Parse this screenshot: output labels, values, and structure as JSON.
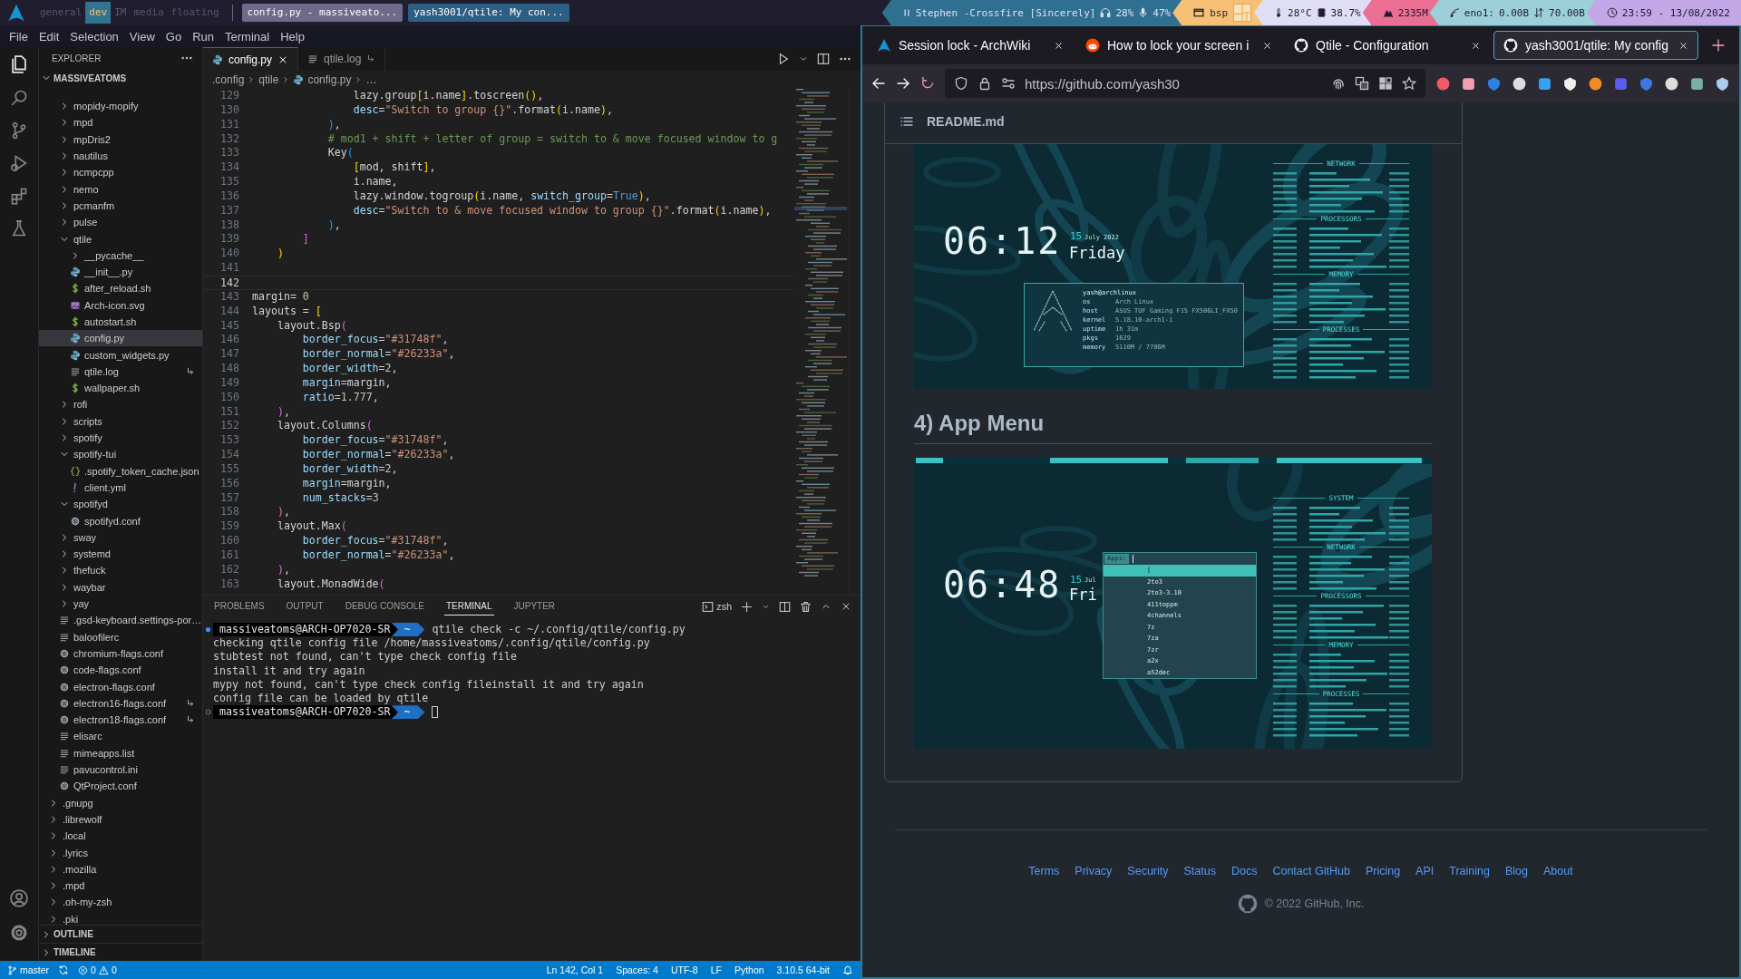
{
  "top_bar": {
    "groups": [
      {
        "label": "general",
        "selected": false
      },
      {
        "label": "dev",
        "selected": true
      },
      {
        "label": "IM",
        "selected": false
      },
      {
        "label": "media",
        "selected": false
      },
      {
        "label": "floating",
        "selected": false
      }
    ],
    "windows": [
      {
        "label": "config.py - massiveato...",
        "color": "#6e6a8a"
      },
      {
        "label": "yash3001/qtile: My con...",
        "color": "#2d5f84"
      }
    ],
    "widgets": [
      {
        "color": "#2f7090",
        "parts": [
          {
            "kind": "pause",
            "text": "Stephen -Crossfire [Sincerely]"
          },
          {
            "kind": "headphones",
            "text": "28%"
          },
          {
            "kind": "mic",
            "text": "47%"
          }
        ]
      },
      {
        "color": "#f6c177",
        "parts": [
          {
            "kind": "window",
            "text": "bsp"
          },
          {
            "kind": "layout"
          }
        ]
      },
      {
        "color": "#e0def4",
        "parts": [
          {
            "kind": "thermometer",
            "text": "28°C"
          },
          {
            "kind": "chip",
            "text": "38.7%"
          }
        ]
      },
      {
        "color": "#eb6f92",
        "parts": [
          {
            "kind": "ram",
            "text": "2335M"
          }
        ]
      },
      {
        "color": "#9ccfd8",
        "parts": [
          {
            "kind": "signal",
            "text": "eno1:"
          },
          {
            "kind": "plain",
            "text": "0.00B"
          },
          {
            "kind": "updown",
            "text": "70.00B"
          }
        ]
      },
      {
        "color": "#c4a7e7",
        "parts": [
          {
            "kind": "clock",
            "text": "23:59 - 13/08/2022"
          }
        ]
      }
    ]
  },
  "vscode": {
    "menu": [
      "File",
      "Edit",
      "Selection",
      "View",
      "Go",
      "Run",
      "Terminal",
      "Help"
    ],
    "explorer": {
      "title": "EXPLORER",
      "root": "MASSIVEATOMS",
      "tree": [
        {
          "children": [
            {
              "name": "mopidy-mopify",
              "kind": "folder",
              "expanded": false,
              "selected": false
            },
            {
              "name": "mpd",
              "kind": "folder",
              "expanded": false,
              "selected": false
            },
            {
              "name": "mpDris2",
              "kind": "folder",
              "expanded": false,
              "selected": false
            },
            {
              "name": "nautilus",
              "kind": "folder",
              "expanded": false,
              "selected": false
            },
            {
              "name": "ncmpcpp",
              "kind": "folder",
              "expanded": false,
              "selected": false
            },
            {
              "name": "nemo",
              "kind": "folder",
              "expanded": false,
              "selected": false
            },
            {
              "name": "pcmanfm",
              "kind": "folder",
              "expanded": false,
              "selected": false
            },
            {
              "name": "pulse",
              "kind": "folder",
              "expanded": false,
              "selected": false
            },
            {
              "name": "qtile",
              "kind": "folder",
              "expanded": true,
              "selected": false,
              "children": [
                {
                  "name": "__pycache__",
                  "kind": "folder",
                  "expanded": false,
                  "selected": false
                },
                {
                  "name": "__init__.py",
                  "kind": "python",
                  "selected": false,
                  "symlink": false
                },
                {
                  "name": "after_reload.sh",
                  "kind": "shell",
                  "selected": false,
                  "symlink": false
                },
                {
                  "name": "Arch-icon.svg",
                  "kind": "svg",
                  "selected": false,
                  "symlink": false
                },
                {
                  "name": "autostart.sh",
                  "kind": "shell",
                  "selected": false,
                  "symlink": false
                },
                {
                  "name": "config.py",
                  "kind": "python",
                  "selected": true,
                  "symlink": false
                },
                {
                  "name": "custom_widgets.py",
                  "kind": "python",
                  "selected": false,
                  "symlink": false
                },
                {
                  "name": "qtile.log",
                  "kind": "text",
                  "selected": false,
                  "symlink": true
                },
                {
                  "name": "wallpaper.sh",
                  "kind": "shell",
                  "selected": false,
                  "symlink": false
                }
              ]
            },
            {
              "name": "rofi",
              "kind": "folder",
              "expanded": false,
              "selected": false
            },
            {
              "name": "scripts",
              "kind": "folder",
              "expanded": false,
              "selected": false
            },
            {
              "name": "spotify",
              "kind": "folder",
              "expanded": false,
              "selected": false
            },
            {
              "name": "spotify-tui",
              "kind": "folder",
              "expanded": true,
              "selected": false,
              "children": [
                {
                  "name": ".spotify_token_cache.json",
                  "kind": "json",
                  "selected": false,
                  "symlink": false
                },
                {
                  "name": "client.yml",
                  "kind": "yaml",
                  "selected": false,
                  "symlink": false
                }
              ]
            },
            {
              "name": "spotifyd",
              "kind": "folder",
              "expanded": true,
              "selected": false,
              "children": [
                {
                  "name": "spotifyd.conf",
                  "kind": "conf",
                  "selected": false,
                  "symlink": false
                }
              ]
            },
            {
              "name": "sway",
              "kind": "folder",
              "expanded": false,
              "selected": false
            },
            {
              "name": "systemd",
              "kind": "folder",
              "expanded": false,
              "selected": false
            },
            {
              "name": "thefuck",
              "kind": "folder",
              "expanded": false,
              "selected": false
            },
            {
              "name": "waybar",
              "kind": "folder",
              "expanded": false,
              "selected": false
            },
            {
              "name": "yay",
              "kind": "folder",
              "expanded": false,
              "selected": false
            },
            {
              "name": ".gsd-keyboard.settings-por…",
              "kind": "text",
              "selected": false,
              "symlink": false
            },
            {
              "name": "baloofilerc",
              "kind": "text",
              "selected": false,
              "symlink": false
            },
            {
              "name": "chromium-flags.conf",
              "kind": "conf",
              "selected": false,
              "symlink": false
            },
            {
              "name": "code-flags.conf",
              "kind": "conf",
              "selected": false,
              "symlink": false
            },
            {
              "name": "electron-flags.conf",
              "kind": "conf",
              "selected": false,
              "symlink": false
            },
            {
              "name": "electron16-flags.conf",
              "kind": "conf",
              "selected": false,
              "symlink": true
            },
            {
              "name": "electron18-flags.conf",
              "kind": "conf",
              "selected": false,
              "symlink": true
            },
            {
              "name": "elisarc",
              "kind": "text",
              "selected": false,
              "symlink": false
            },
            {
              "name": "mimeapps.list",
              "kind": "text",
              "selected": false,
              "symlink": false
            },
            {
              "name": "pavucontrol.ini",
              "kind": "text",
              "selected": false,
              "symlink": false
            },
            {
              "name": "QtProject.conf",
              "kind": "conf",
              "selected": false,
              "symlink": false
            }
          ]
        },
        {
          "name": ".gnupg",
          "kind": "folder",
          "expanded": false,
          "selected": false
        },
        {
          "name": ".librewolf",
          "kind": "folder",
          "expanded": false,
          "selected": false
        },
        {
          "name": ".local",
          "kind": "folder",
          "expanded": false,
          "selected": false
        },
        {
          "name": ".lyrics",
          "kind": "folder",
          "expanded": false,
          "selected": false
        },
        {
          "name": ".mozilla",
          "kind": "folder",
          "expanded": false,
          "selected": false
        },
        {
          "name": ".mpd",
          "kind": "folder",
          "expanded": false,
          "selected": false
        },
        {
          "name": ".oh-my-zsh",
          "kind": "folder",
          "expanded": false,
          "selected": false
        },
        {
          "name": ".pki",
          "kind": "folder",
          "expanded": false,
          "selected": false
        }
      ]
    },
    "sections": [
      {
        "label": "OUTLINE",
        "expanded": false
      },
      {
        "label": "TIMELINE",
        "expanded": false
      }
    ],
    "editor_tabs": [
      {
        "label": "config.py",
        "kind": "python",
        "selected": true,
        "symlink": false
      },
      {
        "label": "qtile.log",
        "kind": "text",
        "selected": false,
        "symlink": true
      }
    ],
    "breadcrumbs": [
      {
        "label": ".config"
      },
      {
        "label": "qtile"
      },
      {
        "label": "config.py",
        "kind": "python"
      },
      {
        "label": "…"
      }
    ],
    "lines": [
      {
        "n": "129",
        "current": false,
        "tokens": [
          {
            "text": "                lazy.group",
            "kind": "plain"
          },
          {
            "text": "[",
            "kind": "gold"
          },
          {
            "text": "i.name",
            "kind": "plain"
          },
          {
            "text": "]",
            "kind": "gold"
          },
          {
            "text": ".toscreen",
            "kind": "plain"
          },
          {
            "text": "()",
            "kind": "gold"
          },
          {
            "text": ",",
            "kind": "plain"
          }
        ]
      },
      {
        "n": "130",
        "current": false,
        "tokens": [
          {
            "text": "                desc",
            "kind": "param"
          },
          {
            "text": "=",
            "kind": "plain"
          },
          {
            "text": "\"Switch to group {}\"",
            "kind": "string"
          },
          {
            "text": ".format",
            "kind": "plain"
          },
          {
            "text": "(",
            "kind": "gold"
          },
          {
            "text": "i.name",
            "kind": "plain"
          },
          {
            "text": ")",
            "kind": "gold"
          },
          {
            "text": ",",
            "kind": "plain"
          }
        ]
      },
      {
        "n": "131",
        "current": false,
        "tokens": [
          {
            "text": "            )",
            "kind": "blue"
          },
          {
            "text": ",",
            "kind": "plain"
          }
        ]
      },
      {
        "n": "132",
        "current": false,
        "tokens": [
          {
            "text": "            # mod1 + shift + letter of group = switch to & move focused window to g",
            "kind": "comment"
          }
        ]
      },
      {
        "n": "133",
        "current": false,
        "tokens": [
          {
            "text": "            Key",
            "kind": "plain"
          },
          {
            "text": "(",
            "kind": "blue"
          }
        ]
      },
      {
        "n": "134",
        "current": false,
        "tokens": [
          {
            "text": "                [",
            "kind": "gold"
          },
          {
            "text": "mod, shift",
            "kind": "plain"
          },
          {
            "text": "]",
            "kind": "gold"
          },
          {
            "text": ",",
            "kind": "plain"
          }
        ]
      },
      {
        "n": "135",
        "current": false,
        "tokens": [
          {
            "text": "                i.name,",
            "kind": "plain"
          }
        ]
      },
      {
        "n": "136",
        "current": false,
        "tokens": [
          {
            "text": "                lazy.window.togroup",
            "kind": "plain"
          },
          {
            "text": "(",
            "kind": "gold"
          },
          {
            "text": "i.name,",
            "kind": "plain"
          },
          {
            "text": " switch_group",
            "kind": "param"
          },
          {
            "text": "=",
            "kind": "plain"
          },
          {
            "text": "True",
            "kind": "constant"
          },
          {
            "text": ")",
            "kind": "gold"
          },
          {
            "text": ",",
            "kind": "plain"
          }
        ]
      },
      {
        "n": "137",
        "current": false,
        "tokens": [
          {
            "text": "                desc",
            "kind": "param"
          },
          {
            "text": "=",
            "kind": "plain"
          },
          {
            "text": "\"Switch to & move focused window to group {}\"",
            "kind": "string"
          },
          {
            "text": ".format",
            "kind": "plain"
          },
          {
            "text": "(",
            "kind": "gold"
          },
          {
            "text": "i.name",
            "kind": "plain"
          },
          {
            "text": ")",
            "kind": "gold"
          },
          {
            "text": ",",
            "kind": "plain"
          }
        ]
      },
      {
        "n": "138",
        "current": false,
        "tokens": [
          {
            "text": "            )",
            "kind": "blue"
          },
          {
            "text": ",",
            "kind": "plain"
          }
        ]
      },
      {
        "n": "139",
        "current": false,
        "tokens": [
          {
            "text": "        ]",
            "kind": "purple"
          }
        ]
      },
      {
        "n": "140",
        "current": false,
        "tokens": [
          {
            "text": "    )",
            "kind": "gold"
          }
        ]
      },
      {
        "n": "141",
        "current": false
      },
      {
        "n": "142",
        "current": true
      },
      {
        "n": "143",
        "current": false,
        "tokens": [
          {
            "text": "margin= ",
            "kind": "plain"
          },
          {
            "text": "0",
            "kind": "number"
          }
        ]
      },
      {
        "n": "144",
        "current": false,
        "tokens": [
          {
            "text": "layouts = ",
            "kind": "plain"
          },
          {
            "text": "[",
            "kind": "gold"
          }
        ]
      },
      {
        "n": "145",
        "current": false,
        "tokens": [
          {
            "text": "    layout.Bsp",
            "kind": "plain"
          },
          {
            "text": "(",
            "kind": "purple"
          }
        ]
      },
      {
        "n": "146",
        "current": false,
        "tokens": [
          {
            "text": "        border_focus",
            "kind": "param"
          },
          {
            "text": "=",
            "kind": "plain"
          },
          {
            "text": "\"#31748f\"",
            "kind": "string"
          },
          {
            "text": ",",
            "kind": "plain"
          }
        ]
      },
      {
        "n": "147",
        "current": false,
        "tokens": [
          {
            "text": "        border_normal",
            "kind": "param"
          },
          {
            "text": "=",
            "kind": "plain"
          },
          {
            "text": "\"#26233a\"",
            "kind": "string"
          },
          {
            "text": ",",
            "kind": "plain"
          }
        ]
      },
      {
        "n": "148",
        "current": false,
        "tokens": [
          {
            "text": "        border_width",
            "kind": "param"
          },
          {
            "text": "=",
            "kind": "plain"
          },
          {
            "text": "2",
            "kind": "number"
          },
          {
            "text": ",",
            "kind": "plain"
          }
        ]
      },
      {
        "n": "149",
        "current": false,
        "tokens": [
          {
            "text": "        margin",
            "kind": "param"
          },
          {
            "text": "=margin,",
            "kind": "plain"
          }
        ]
      },
      {
        "n": "150",
        "current": false,
        "tokens": [
          {
            "text": "        ratio",
            "kind": "param"
          },
          {
            "text": "=",
            "kind": "plain"
          },
          {
            "text": "1.777",
            "kind": "number"
          },
          {
            "text": ",",
            "kind": "plain"
          }
        ]
      },
      {
        "n": "151",
        "current": false,
        "tokens": [
          {
            "text": "    )",
            "kind": "purple"
          },
          {
            "text": ",",
            "kind": "plain"
          }
        ]
      },
      {
        "n": "152",
        "current": false,
        "tokens": [
          {
            "text": "    layout.Columns",
            "kind": "plain"
          },
          {
            "text": "(",
            "kind": "purple"
          }
        ]
      },
      {
        "n": "153",
        "current": false,
        "tokens": [
          {
            "text": "        border_focus",
            "kind": "param"
          },
          {
            "text": "=",
            "kind": "plain"
          },
          {
            "text": "\"#31748f\"",
            "kind": "string"
          },
          {
            "text": ",",
            "kind": "plain"
          }
        ]
      },
      {
        "n": "154",
        "current": false,
        "tokens": [
          {
            "text": "        border_normal",
            "kind": "param"
          },
          {
            "text": "=",
            "kind": "plain"
          },
          {
            "text": "\"#26233a\"",
            "kind": "string"
          },
          {
            "text": ",",
            "kind": "plain"
          }
        ]
      },
      {
        "n": "155",
        "current": false,
        "tokens": [
          {
            "text": "        border_width",
            "kind": "param"
          },
          {
            "text": "=",
            "kind": "plain"
          },
          {
            "text": "2",
            "kind": "number"
          },
          {
            "text": ",",
            "kind": "plain"
          }
        ]
      },
      {
        "n": "156",
        "current": false,
        "tokens": [
          {
            "text": "        margin",
            "kind": "param"
          },
          {
            "text": "=margin,",
            "kind": "plain"
          }
        ]
      },
      {
        "n": "157",
        "current": false,
        "tokens": [
          {
            "text": "        num_stacks",
            "kind": "param"
          },
          {
            "text": "=",
            "kind": "plain"
          },
          {
            "text": "3",
            "kind": "number"
          }
        ]
      },
      {
        "n": "158",
        "current": false,
        "tokens": [
          {
            "text": "    )",
            "kind": "purple"
          },
          {
            "text": ",",
            "kind": "plain"
          }
        ]
      },
      {
        "n": "159",
        "current": false,
        "tokens": [
          {
            "text": "    layout.Max",
            "kind": "plain"
          },
          {
            "text": "(",
            "kind": "purple"
          }
        ]
      },
      {
        "n": "160",
        "current": false,
        "tokens": [
          {
            "text": "        border_focus",
            "kind": "param"
          },
          {
            "text": "=",
            "kind": "plain"
          },
          {
            "text": "\"#31748f\"",
            "kind": "string"
          },
          {
            "text": ",",
            "kind": "plain"
          }
        ]
      },
      {
        "n": "161",
        "current": false,
        "tokens": [
          {
            "text": "        border_normal",
            "kind": "param"
          },
          {
            "text": "=",
            "kind": "plain"
          },
          {
            "text": "\"#26233a\"",
            "kind": "string"
          },
          {
            "text": ",",
            "kind": "plain"
          }
        ]
      },
      {
        "n": "162",
        "current": false,
        "tokens": [
          {
            "text": "    )",
            "kind": "purple"
          },
          {
            "text": ",",
            "kind": "plain"
          }
        ]
      },
      {
        "n": "163",
        "current": false,
        "tokens": [
          {
            "text": "    layout.MonadWide",
            "kind": "plain"
          },
          {
            "text": "(",
            "kind": "purple"
          }
        ]
      }
    ],
    "panel_tabs": [
      {
        "label": "PROBLEMS",
        "selected": false
      },
      {
        "label": "OUTPUT",
        "selected": false
      },
      {
        "label": "DEBUG CONSOLE",
        "selected": false
      },
      {
        "label": "TERMINAL",
        "selected": true
      },
      {
        "label": "JUPYTER",
        "selected": false
      }
    ],
    "terminal": {
      "shell": "zsh",
      "lines": [
        {
          "kind": "prompt",
          "user": "massiveatoms@ARCH-OP7020-SR",
          "dir": "~",
          "command": "qtile check -c ~/.config/qtile/config.py"
        },
        {
          "kind": "output",
          "text": "checking qtile config file /home/massiveatoms/.config/qtile/config.py"
        },
        {
          "kind": "output",
          "text": "stubtest not found, can't type check config file"
        },
        {
          "kind": "output",
          "text": "install it and try again"
        },
        {
          "kind": "output",
          "text": "mypy not found, can't type check config fileinstall it and try again"
        },
        {
          "kind": "output",
          "text": "config file can be loaded by qtile"
        },
        {
          "kind": "prompt",
          "user": "massiveatoms@ARCH-OP7020-SR",
          "dir": "~"
        }
      ]
    },
    "status": {
      "branch": "master",
      "errors": "0",
      "warnings": "0",
      "right": [
        "Ln 142, Col 1",
        "Spaces: 4",
        "UTF-8",
        "LF",
        "Python",
        "3.10.5 64-bit"
      ]
    }
  },
  "browser": {
    "tabs": [
      {
        "title": "Session lock - ArchWiki",
        "kind": "arch",
        "selected": false
      },
      {
        "title": "How to lock your screen i",
        "kind": "reddit",
        "selected": false
      },
      {
        "title": "Qtile - Configuration",
        "kind": "github",
        "selected": false
      },
      {
        "title": "yash3001/qtile: My config",
        "kind": "github",
        "selected": true
      }
    ],
    "url": "https://github.com/yash30",
    "readme": {
      "title": "README.md",
      "blocks": [
        {
          "kind": "screenshot",
          "clock": "06:12",
          "day": "15",
          "month": "July 2022",
          "weekday": "Friday",
          "fetch": {
            "title": "yash@archlinux",
            "rows": [
              {
                "key": "os",
                "value": "Arch Linux"
              },
              {
                "key": "host",
                "value": "ASUS TUF Gaming F15 FX506LI_FX50"
              },
              {
                "key": "kernel",
                "value": "5.18.10-arch1-1"
              },
              {
                "key": "uptime",
                "value": "1h 31m"
              },
              {
                "key": "pkgs",
                "value": "1629"
              },
              {
                "key": "memory",
                "value": "5110M / 7786M"
              }
            ]
          },
          "monitor": [
            "NETWORK",
            "PROCESSORS",
            "MEMORY",
            "PROCESSES"
          ]
        },
        {
          "kind": "heading",
          "text": "4) App Menu"
        },
        {
          "kind": "screenshot",
          "bar": true,
          "clock": "06:48",
          "day": "15",
          "month": "Jul",
          "weekday": "Fri",
          "menu": {
            "prompt": "Apps:",
            "items": [
              {
                "label": "[",
                "selected": true
              },
              {
                "label": "2to3",
                "selected": false
              },
              {
                "label": "2to3-3.10",
                "selected": false
              },
              {
                "label": "411toppm",
                "selected": false
              },
              {
                "label": "4channels",
                "selected": false
              },
              {
                "label": "7z",
                "selected": false
              },
              {
                "label": "7za",
                "selected": false
              },
              {
                "label": "7zr",
                "selected": false
              },
              {
                "label": "a2x",
                "selected": false
              },
              {
                "label": "a52dec",
                "selected": false
              }
            ]
          },
          "monitor": [
            "SYSTEM",
            "NETWORK",
            "PROCESSORS",
            "MEMORY",
            "PROCESSES"
          ]
        }
      ]
    },
    "footer": {
      "links": [
        "Terms",
        "Privacy",
        "Security",
        "Status",
        "Docs",
        "Contact GitHub",
        "Pricing",
        "API",
        "Training",
        "Blog",
        "About"
      ],
      "copyright": "© 2022 GitHub, Inc."
    }
  }
}
